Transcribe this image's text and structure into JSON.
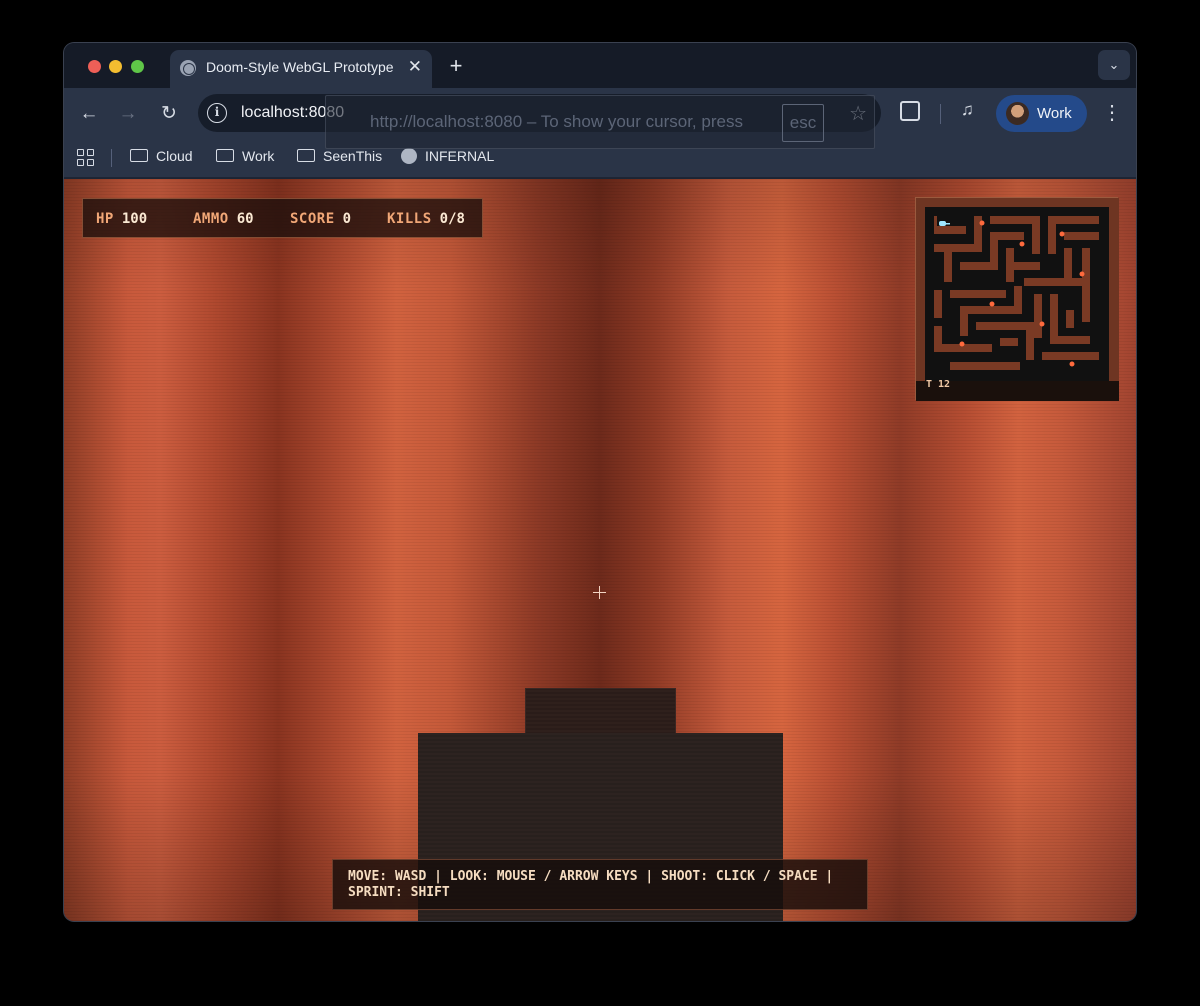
{
  "browser": {
    "tab_title": "Doom-Style WebGL Prototype",
    "tab_close": "✕",
    "new_tab": "+",
    "tab_search": "⌄",
    "address": "localhost:8080",
    "back": "←",
    "forward": "→",
    "reload": "↻",
    "star": "☆",
    "media": "♫",
    "menu": "⋮",
    "profile_label": "Work",
    "bookmarks": [
      {
        "label": "Cloud",
        "icon": "folder-icon"
      },
      {
        "label": "Work",
        "icon": "folder-icon"
      },
      {
        "label": "SeenThis",
        "icon": "folder-icon"
      },
      {
        "label": "INFERNAL",
        "icon": "globe-icon"
      }
    ],
    "pointer_lock_hint": "http://localhost:8080 – To show your cursor, press",
    "pointer_lock_key": "esc"
  },
  "hud": {
    "hp_label": "HP",
    "hp_value": "100",
    "ammo_label": "AMMO",
    "ammo_value": "60",
    "score_label": "SCORE",
    "score_value": "0",
    "kills_label": "KILLS",
    "kills_value": "0/8",
    "minimap_label": "T 12",
    "controls_text": "MOVE: WASD | LOOK: MOUSE / ARROW KEYS | SHOOT: CLICK / SPACE | SPRINT: SHIFT"
  },
  "colors": {
    "wall": "#c65a3b",
    "minimap_floor": "#111111",
    "minimap_wall": "#7a3a24",
    "enemy_dot": "#ff6a3d",
    "player_marker": "#9fe6ff"
  }
}
